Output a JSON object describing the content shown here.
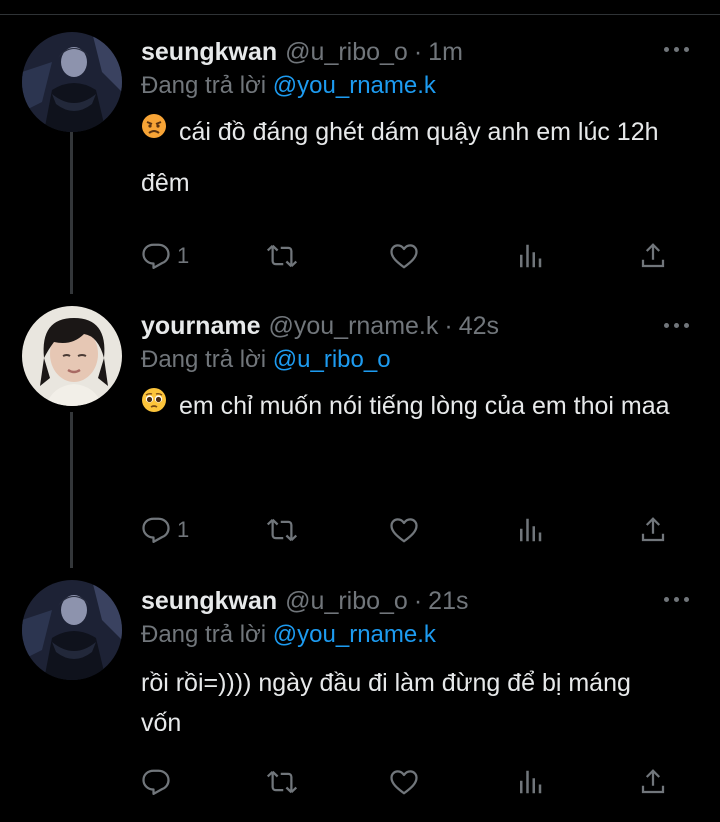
{
  "tweets": [
    {
      "name": "seungkwan",
      "handle": "@u_ribo_o",
      "time": "1m",
      "reply_prefix": "Đang trả lời",
      "reply_to": "@you_rname.k",
      "emoji": "angry-face",
      "text": "cái đồ đáng ghét dám quậy anh em lúc 12h đêm",
      "reply_count": "1"
    },
    {
      "name": "yourname",
      "handle": "@you_rname.k",
      "time": "42s",
      "reply_prefix": "Đang trả lời",
      "reply_to": "@u_ribo_o",
      "emoji": "pleading-face",
      "text": "em chỉ muốn nói tiếng lòng của em thoi maa",
      "reply_count": "1"
    },
    {
      "name": "seungkwan",
      "handle": "@u_ribo_o",
      "time": "21s",
      "reply_prefix": "Đang trả lời",
      "reply_to": "@you_rname.k",
      "emoji": "",
      "text": "rồi rồi=)))) ngày đầu đi làm đừng để bị máng vốn",
      "reply_count": ""
    }
  ],
  "colors": {
    "background": "#000000",
    "primary_text": "#e7e9ea",
    "secondary_text": "#71767b",
    "mention": "#1d9bf0",
    "thread_line": "#333639"
  },
  "icons": [
    "reply-icon",
    "retweet-icon",
    "like-icon",
    "views-icon",
    "share-icon",
    "more-icon"
  ]
}
